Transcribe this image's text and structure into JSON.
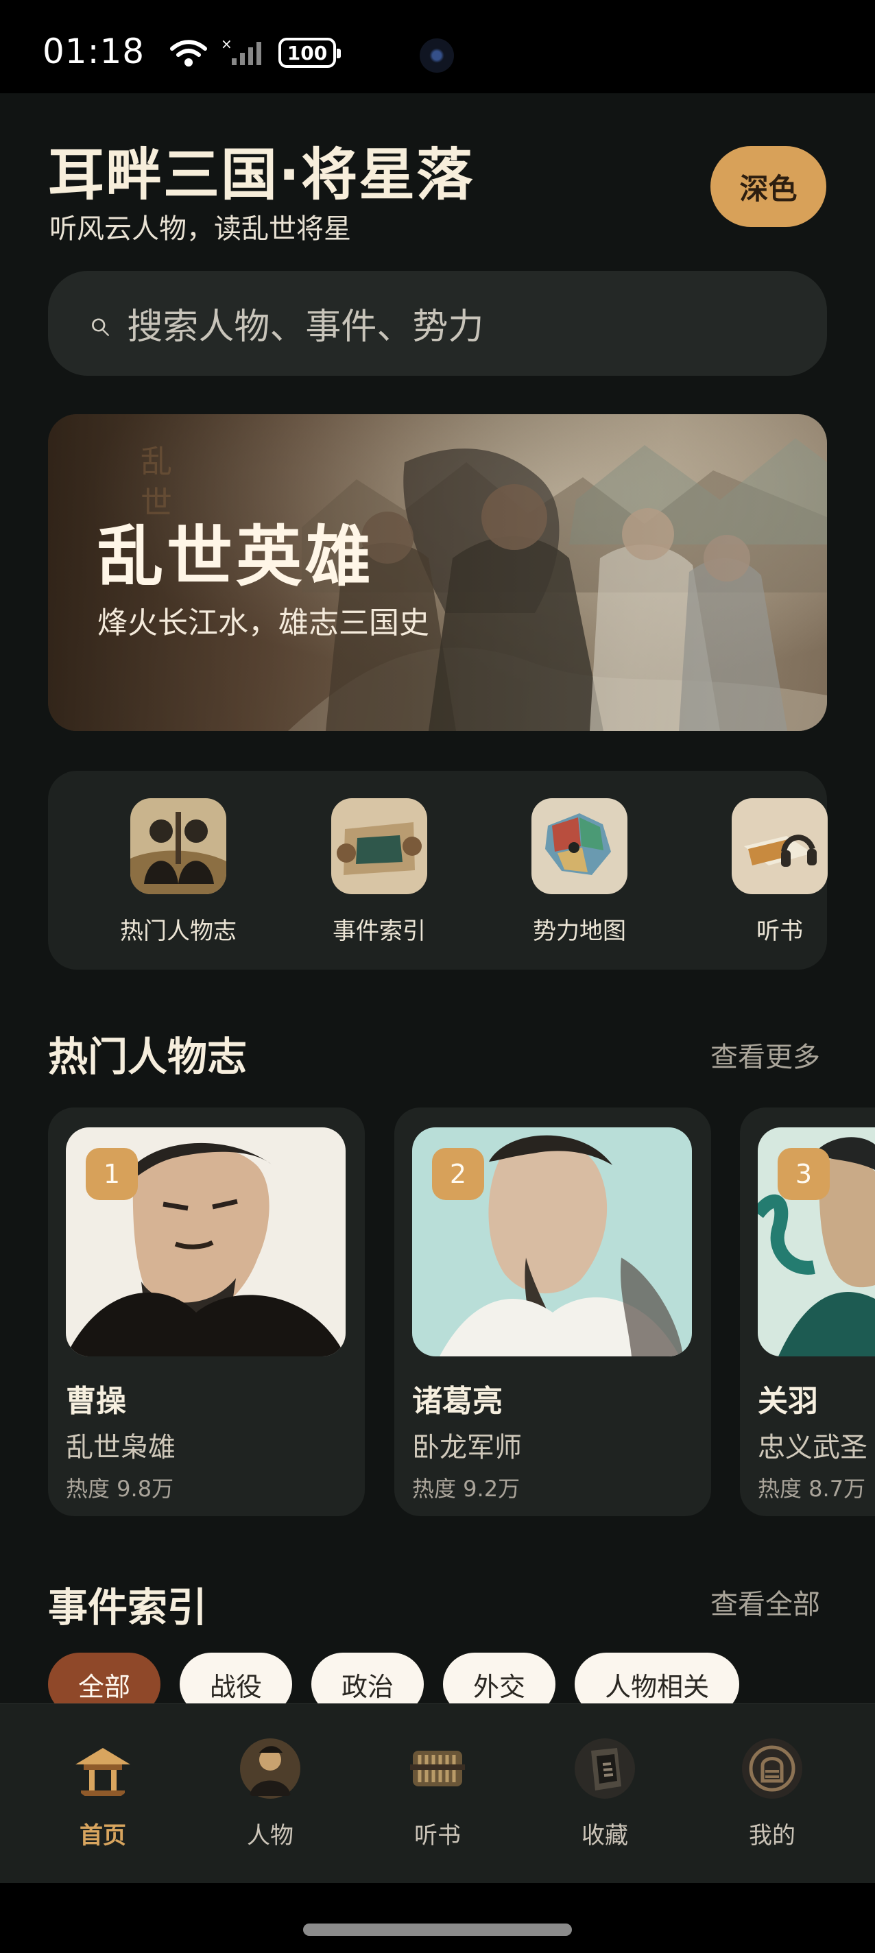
{
  "status_bar": {
    "time": "01:18",
    "battery": "100",
    "wifi_icon": "wifi-icon",
    "signal_icon": "signal-icon"
  },
  "header": {
    "title": "耳畔三国·将星落",
    "subtitle": "听风云人物，读乱世将星",
    "theme_button": "深色"
  },
  "search": {
    "placeholder": "搜索人物、事件、势力",
    "icon": "search-icon"
  },
  "hero": {
    "title": "乱世英雄",
    "subtitle": "烽火长江水，雄志三国史",
    "art_text": "乱世"
  },
  "quick_links": [
    {
      "label": "热门人物志",
      "icon": "portrait-duo-icon"
    },
    {
      "label": "事件索引",
      "icon": "scroll-icon"
    },
    {
      "label": "势力地图",
      "icon": "map-icon"
    },
    {
      "label": "听书",
      "icon": "headphones-book-icon"
    }
  ],
  "popular": {
    "title": "热门人物志",
    "more": "查看更多",
    "people": [
      {
        "rank": "1",
        "name": "曹操",
        "title": "乱世枭雄",
        "heat": "热度 9.8万"
      },
      {
        "rank": "2",
        "name": "诸葛亮",
        "title": "卧龙军师",
        "heat": "热度 9.2万"
      },
      {
        "rank": "3",
        "name": "关羽",
        "title": "忠义武圣",
        "heat": "热度 8.7万"
      }
    ]
  },
  "events": {
    "title": "事件索引",
    "more": "查看全部",
    "chips": [
      "全部",
      "战役",
      "政治",
      "外交",
      "人物相关"
    ],
    "selected": "全部"
  },
  "bottom_nav": {
    "items": [
      {
        "label": "首页",
        "icon": "pavilion-icon"
      },
      {
        "label": "人物",
        "icon": "person-icon"
      },
      {
        "label": "听书",
        "icon": "bamboo-book-icon"
      },
      {
        "label": "收藏",
        "icon": "collection-book-icon"
      },
      {
        "label": "我的",
        "icon": "seal-profile-icon"
      }
    ],
    "active": "首页"
  },
  "colors": {
    "background": "#111413",
    "accent": "#d8a159",
    "chip_active": "#8f4829",
    "card": "#1f2321"
  }
}
